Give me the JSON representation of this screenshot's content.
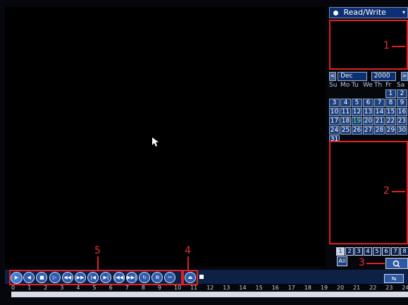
{
  "playback": {
    "mode": "Read/Write"
  },
  "calendar": {
    "month": "Dec",
    "year": "2000",
    "prev": "<",
    "next": ">",
    "weekdays": [
      "Su",
      "Mo",
      "Tu",
      "We",
      "Th",
      "Fr",
      "Sa"
    ],
    "days": [
      "",
      "",
      "",
      "",
      "",
      "1",
      "2",
      "3",
      "4",
      "5",
      "6",
      "7",
      "8",
      "9",
      "10",
      "11",
      "12",
      "13",
      "14",
      "15",
      "16",
      "17",
      "18",
      "19",
      "20",
      "21",
      "22",
      "23",
      "24",
      "25",
      "26",
      "27",
      "28",
      "29",
      "30",
      "31"
    ],
    "selected_day": "19"
  },
  "channels": {
    "numbers": [
      "1",
      "2",
      "3",
      "4",
      "5",
      "6",
      "7",
      "8"
    ],
    "selected": "1",
    "all_label": "All"
  },
  "annotations": {
    "n1": "1",
    "n2": "2",
    "n3": "3",
    "n4": "4",
    "n5": "5"
  },
  "controls": {
    "buttons": [
      "play",
      "reverse",
      "stop",
      "slow",
      "fast-back",
      "fast-forward",
      "prev-frame",
      "next-frame",
      "prev-file",
      "next-file",
      "loop",
      "fullscreen",
      "clip",
      "backup"
    ]
  },
  "timeline": {
    "hours": [
      "0",
      "1",
      "2",
      "3",
      "4",
      "5",
      "6",
      "7",
      "8",
      "9",
      "10",
      "11",
      "12",
      "13",
      "14",
      "15",
      "16",
      "17",
      "18",
      "19",
      "20",
      "21",
      "22",
      "23",
      "24"
    ]
  },
  "colors": {
    "annotation": "#e02020",
    "panel": "#0d2f73",
    "highlight": "#7df06c"
  }
}
